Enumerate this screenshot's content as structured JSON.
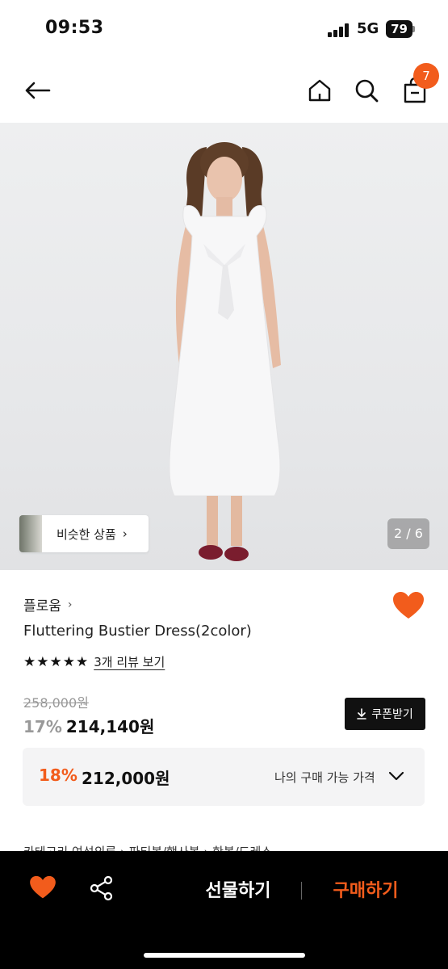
{
  "status_bar": {
    "time": "09:53",
    "network": "5G",
    "battery": "79"
  },
  "header": {
    "icons": [
      "back-arrow-icon",
      "home-icon",
      "search-icon",
      "shopping-bag-icon"
    ],
    "cart_count": "7"
  },
  "gallery": {
    "similar_label": "비슷한 상품",
    "similar_chevron": "›",
    "page": "2 / 6"
  },
  "product": {
    "brand": "플로움",
    "brand_chevron": "›",
    "name": "Fluttering Bustier Dress(2color)",
    "stars": "★★★★★",
    "rating": 5,
    "review_link": "3개 리뷰 보기",
    "original_price": "258,000원",
    "discount_rate": "17%",
    "sale_price": "214,140원",
    "coupon_button": "쿠폰받기",
    "liked": true
  },
  "my_price": {
    "rate": "18%",
    "value": "212,000원",
    "label": "나의 구매 가능 가격"
  },
  "category": {
    "text": "카테고리 여성의류 › 파티복/행사복 › 한복/드레스"
  },
  "bottom_bar": {
    "gift_label": "선물하기",
    "buy_label": "구매하기"
  },
  "colors": {
    "accent": "#f25c1c",
    "black": "#000000",
    "text": "#111111",
    "muted": "#999999",
    "panel": "#f4f4f5"
  }
}
